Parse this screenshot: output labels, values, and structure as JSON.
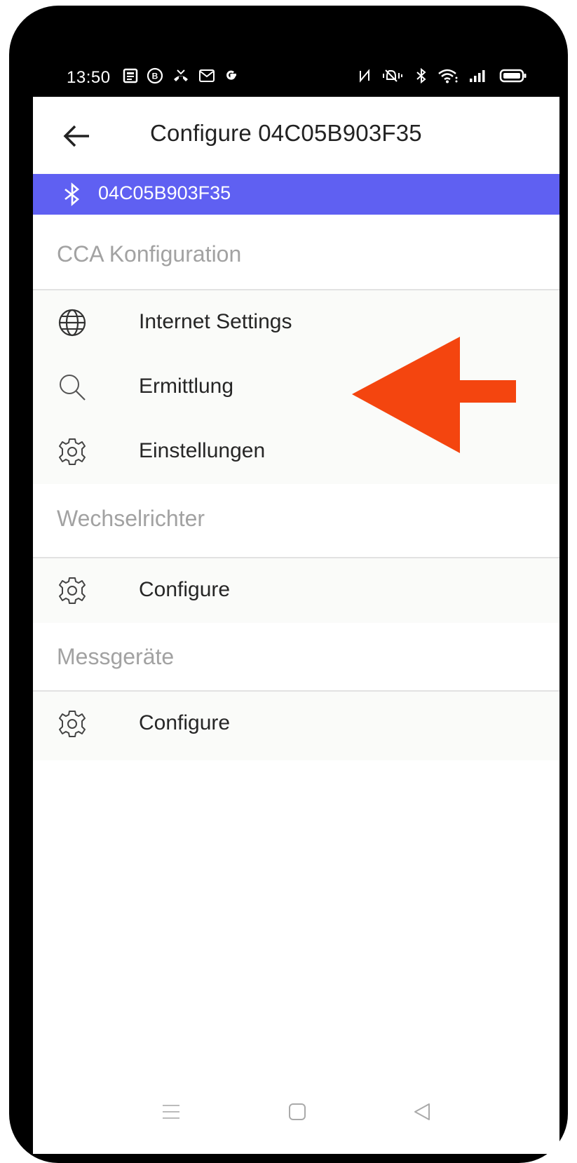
{
  "status_bar": {
    "time": "13:50",
    "left_icons": [
      "news-icon",
      "b-circle-icon",
      "missed-call-icon",
      "gmail-icon",
      "google-icon"
    ],
    "right_icons": [
      "nfc-icon",
      "mute-vibrate-icon",
      "bluetooth-icon",
      "wifi-icon",
      "signal-icon",
      "battery-icon"
    ]
  },
  "app_bar": {
    "title": "Configure 04C05B903F35",
    "back_icon": "arrow-left-icon"
  },
  "bluetooth_bar": {
    "device_id": "04C05B903F35",
    "color": "#5f60f2"
  },
  "sections": {
    "cca": {
      "header": "CCA Konfiguration",
      "items": [
        {
          "label": "Internet Settings",
          "icon": "globe-icon"
        },
        {
          "label": "Ermittlung",
          "icon": "search-icon"
        },
        {
          "label": "Einstellungen",
          "icon": "gear-icon"
        }
      ]
    },
    "inverter": {
      "header": "Wechselrichter",
      "items": [
        {
          "label": "Configure",
          "icon": "gear-icon"
        }
      ]
    },
    "meters": {
      "header": "Messgeräte",
      "items": [
        {
          "label": "Configure",
          "icon": "gear-icon"
        }
      ]
    }
  },
  "annotation": {
    "arrow_color": "#f4450f",
    "points_to": "Ermittlung"
  },
  "nav_bar": {
    "buttons": [
      "menu-icon",
      "home-icon",
      "back-icon"
    ]
  }
}
